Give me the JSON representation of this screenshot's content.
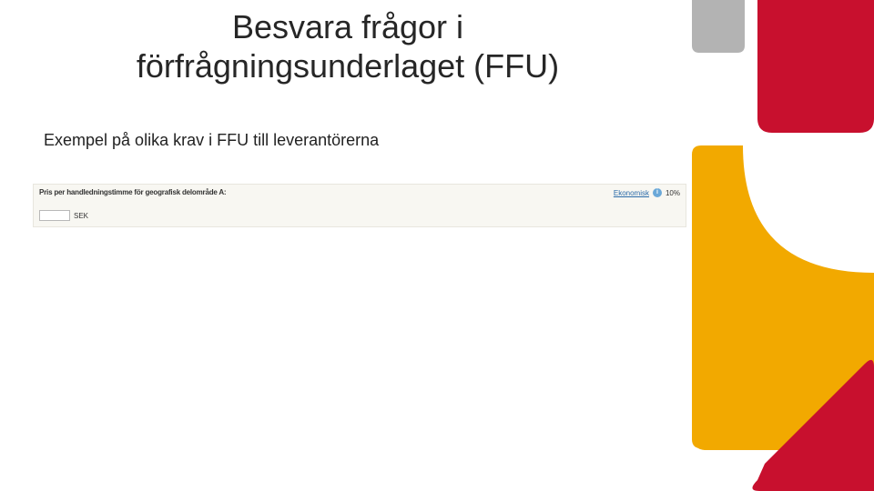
{
  "title": "Besvara frågor i förfrågningsunderlaget (FFU)",
  "subtitle": "Exempel på olika krav i FFU till leverantörerna",
  "form": {
    "label": "Pris per handledningstimme för geografisk delområde A:",
    "link": "Ekonomisk",
    "percent": "10%",
    "suffix": "SEK"
  },
  "colors": {
    "red": "#c8102e",
    "yellow": "#f2a900",
    "grey": "#b3b3b3"
  }
}
